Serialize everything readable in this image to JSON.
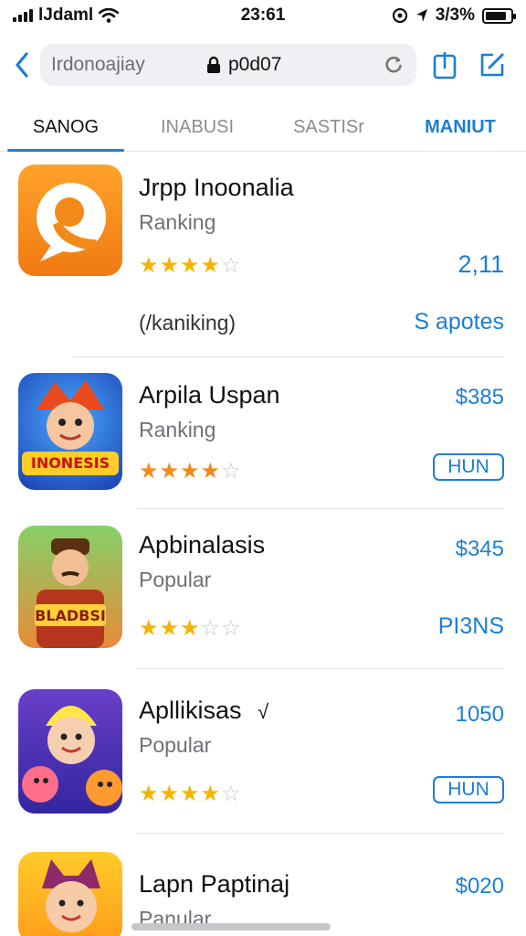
{
  "status": {
    "carrier": "lJdaml",
    "time": "23:61",
    "battery_text": "3/3%",
    "battery_level": 0.85
  },
  "browser": {
    "url_left": "Irdonoajiay",
    "url_center": "p0d07",
    "icons": [
      "back-chevron-icon",
      "lock-icon",
      "reload-icon",
      "share-icon",
      "edit-icon"
    ]
  },
  "tabs": [
    {
      "label": "SANOG",
      "active": true
    },
    {
      "label": "INABUSI",
      "active": false
    },
    {
      "label": "SASTISr",
      "active": false
    },
    {
      "label": "MANIUT",
      "active": false
    }
  ],
  "apps": [
    {
      "name": "Jrpp Inoonalia",
      "subtitle": "Ranking",
      "rating": 4,
      "price": "2,11",
      "extra_left": "(/kaniking)",
      "extra_right": "S apotes"
    },
    {
      "name": "Arpila Uspan",
      "subtitle": "Ranking",
      "rating": 4,
      "price": "$385",
      "button": "HUN",
      "icon_text": "INONESIS"
    },
    {
      "name": "Apbinalasis",
      "subtitle": "Popular",
      "rating": 3,
      "price": "$345",
      "secondary": "PI3NS",
      "icon_text": "BLADBSI"
    },
    {
      "name": "Apllikisas",
      "subtitle": "Popular",
      "rating": 4,
      "price": "1050",
      "button": "HUN",
      "name_suffix": "√"
    },
    {
      "name": "Lapn Paptinaj",
      "subtitle": "Panular",
      "price": "$020"
    }
  ],
  "colors": {
    "accent": "#1c7ed6",
    "star": "#f5b400"
  }
}
